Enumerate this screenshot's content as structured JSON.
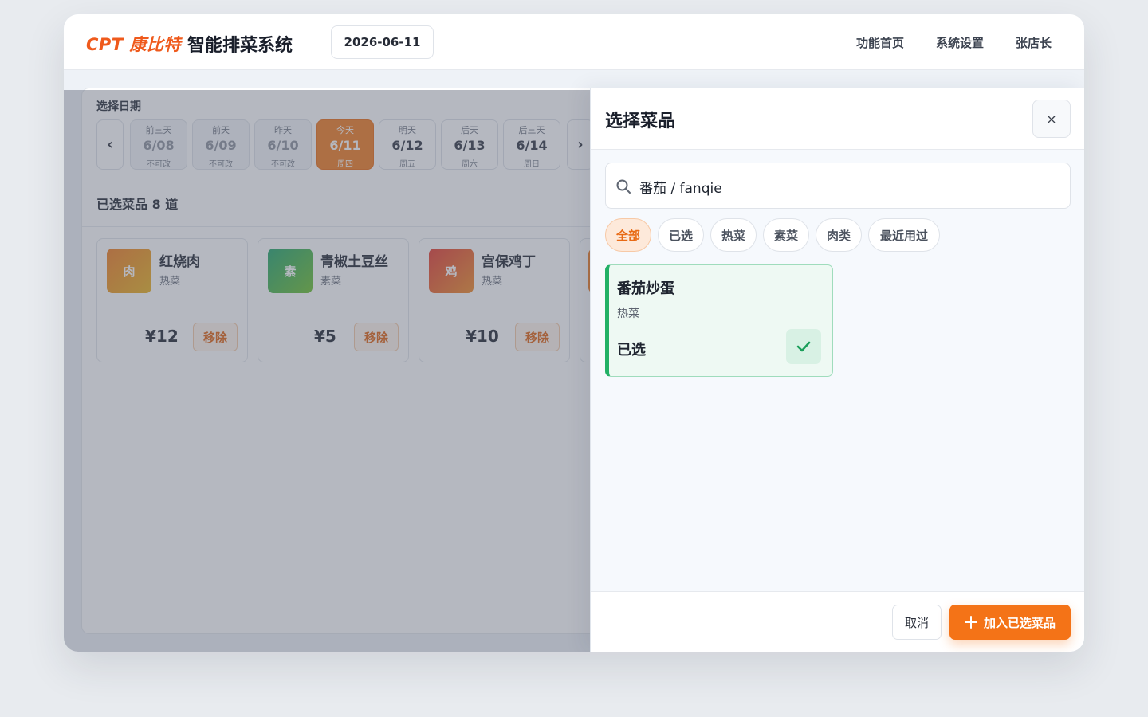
{
  "header": {
    "brand": "CPT 康比特",
    "title": "智能排菜系统",
    "date": "2026-06-11",
    "nav": [
      "功能首页",
      "系统设置",
      "张店长"
    ]
  },
  "date_picker": {
    "label": "选择日期",
    "prev_icon": "chevron-left-icon",
    "next_icon": "chevron-right-icon",
    "days": [
      {
        "label": "前三天",
        "date": "6/08",
        "note": "不可改",
        "state": "past"
      },
      {
        "label": "前天",
        "date": "6/09",
        "note": "不可改",
        "state": "past"
      },
      {
        "label": "昨天",
        "date": "6/10",
        "note": "不可改",
        "state": "past"
      },
      {
        "label": "今天",
        "date": "6/11",
        "note": "周四",
        "state": "today"
      },
      {
        "label": "明天",
        "date": "6/12",
        "note": "周五",
        "state": "future"
      },
      {
        "label": "后天",
        "date": "6/13",
        "note": "周六",
        "state": "future"
      },
      {
        "label": "后三天",
        "date": "6/14",
        "note": "周日",
        "state": "future"
      }
    ]
  },
  "selected": {
    "title": "已选菜品 8 道",
    "remove_label": "移除",
    "dishes": [
      {
        "icon_text": "肉",
        "name": "红烧肉",
        "category": "热菜",
        "price": "¥12",
        "color": "#f0901c"
      },
      {
        "icon_text": "素",
        "name": "青椒土豆丝",
        "category": "素菜",
        "price": "¥5",
        "color": "#3bb54a"
      },
      {
        "icon_text": "鸡",
        "name": "宫保鸡丁",
        "category": "热菜",
        "price": "¥10",
        "color": "#e8482c"
      }
    ]
  },
  "drawer": {
    "title": "选择菜品",
    "close_label": "×",
    "search_value": "番茄 / fanqie",
    "filters": [
      "全部",
      "已选",
      "热菜",
      "素菜",
      "肉类",
      "最近用过"
    ],
    "active_filter": "全部",
    "results": [
      {
        "name": "番茄炒蛋",
        "category": "热菜",
        "status": "已选"
      }
    ],
    "cancel_label": "取消",
    "add_label": "加入已选菜品",
    "accent": "#f47317",
    "success": "#22b066"
  }
}
